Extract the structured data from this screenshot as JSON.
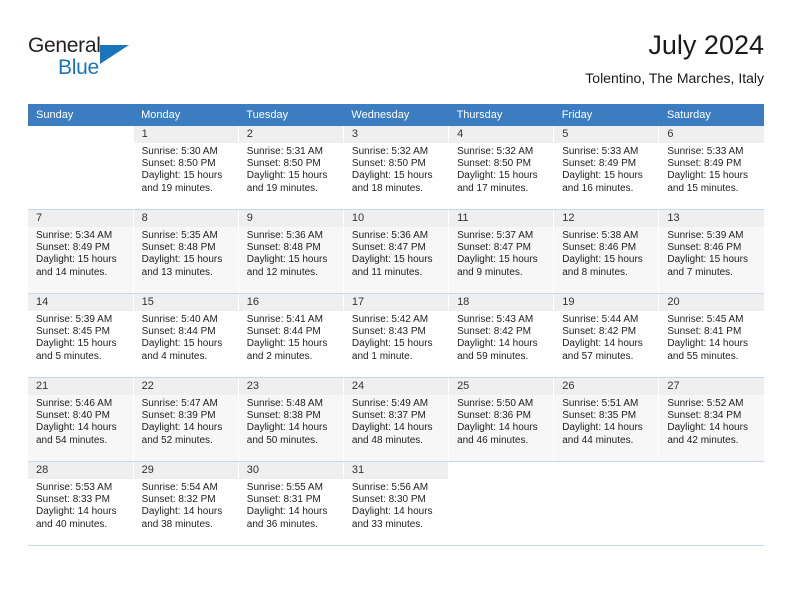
{
  "logo": {
    "word1": "General",
    "word2": "Blue",
    "triangle_color": "#1b75bb",
    "text_color": "#231f20"
  },
  "header": {
    "title": "July 2024",
    "subtitle": "Tolentino, The Marches, Italy"
  },
  "theme": {
    "header_row_bg": "#3b7dc0",
    "header_row_text": "#ffffff",
    "daynum_bg": "#efefef",
    "grid_line": "#c8d8e8"
  },
  "weekday_headers": [
    "Sunday",
    "Monday",
    "Tuesday",
    "Wednesday",
    "Thursday",
    "Friday",
    "Saturday"
  ],
  "weeks": [
    [
      {
        "day": "",
        "sunrise": "",
        "sunset": "",
        "daylight_line1": "",
        "daylight_line2": "",
        "empty": true
      },
      {
        "day": "1",
        "sunrise": "Sunrise: 5:30 AM",
        "sunset": "Sunset: 8:50 PM",
        "daylight_line1": "Daylight: 15 hours",
        "daylight_line2": "and 19 minutes.",
        "empty": false
      },
      {
        "day": "2",
        "sunrise": "Sunrise: 5:31 AM",
        "sunset": "Sunset: 8:50 PM",
        "daylight_line1": "Daylight: 15 hours",
        "daylight_line2": "and 19 minutes.",
        "empty": false
      },
      {
        "day": "3",
        "sunrise": "Sunrise: 5:32 AM",
        "sunset": "Sunset: 8:50 PM",
        "daylight_line1": "Daylight: 15 hours",
        "daylight_line2": "and 18 minutes.",
        "empty": false
      },
      {
        "day": "4",
        "sunrise": "Sunrise: 5:32 AM",
        "sunset": "Sunset: 8:50 PM",
        "daylight_line1": "Daylight: 15 hours",
        "daylight_line2": "and 17 minutes.",
        "empty": false
      },
      {
        "day": "5",
        "sunrise": "Sunrise: 5:33 AM",
        "sunset": "Sunset: 8:49 PM",
        "daylight_line1": "Daylight: 15 hours",
        "daylight_line2": "and 16 minutes.",
        "empty": false
      },
      {
        "day": "6",
        "sunrise": "Sunrise: 5:33 AM",
        "sunset": "Sunset: 8:49 PM",
        "daylight_line1": "Daylight: 15 hours",
        "daylight_line2": "and 15 minutes.",
        "empty": false
      }
    ],
    [
      {
        "day": "7",
        "sunrise": "Sunrise: 5:34 AM",
        "sunset": "Sunset: 8:49 PM",
        "daylight_line1": "Daylight: 15 hours",
        "daylight_line2": "and 14 minutes.",
        "empty": false
      },
      {
        "day": "8",
        "sunrise": "Sunrise: 5:35 AM",
        "sunset": "Sunset: 8:48 PM",
        "daylight_line1": "Daylight: 15 hours",
        "daylight_line2": "and 13 minutes.",
        "empty": false
      },
      {
        "day": "9",
        "sunrise": "Sunrise: 5:36 AM",
        "sunset": "Sunset: 8:48 PM",
        "daylight_line1": "Daylight: 15 hours",
        "daylight_line2": "and 12 minutes.",
        "empty": false
      },
      {
        "day": "10",
        "sunrise": "Sunrise: 5:36 AM",
        "sunset": "Sunset: 8:47 PM",
        "daylight_line1": "Daylight: 15 hours",
        "daylight_line2": "and 11 minutes.",
        "empty": false
      },
      {
        "day": "11",
        "sunrise": "Sunrise: 5:37 AM",
        "sunset": "Sunset: 8:47 PM",
        "daylight_line1": "Daylight: 15 hours",
        "daylight_line2": "and 9 minutes.",
        "empty": false
      },
      {
        "day": "12",
        "sunrise": "Sunrise: 5:38 AM",
        "sunset": "Sunset: 8:46 PM",
        "daylight_line1": "Daylight: 15 hours",
        "daylight_line2": "and 8 minutes.",
        "empty": false
      },
      {
        "day": "13",
        "sunrise": "Sunrise: 5:39 AM",
        "sunset": "Sunset: 8:46 PM",
        "daylight_line1": "Daylight: 15 hours",
        "daylight_line2": "and 7 minutes.",
        "empty": false
      }
    ],
    [
      {
        "day": "14",
        "sunrise": "Sunrise: 5:39 AM",
        "sunset": "Sunset: 8:45 PM",
        "daylight_line1": "Daylight: 15 hours",
        "daylight_line2": "and 5 minutes.",
        "empty": false
      },
      {
        "day": "15",
        "sunrise": "Sunrise: 5:40 AM",
        "sunset": "Sunset: 8:44 PM",
        "daylight_line1": "Daylight: 15 hours",
        "daylight_line2": "and 4 minutes.",
        "empty": false
      },
      {
        "day": "16",
        "sunrise": "Sunrise: 5:41 AM",
        "sunset": "Sunset: 8:44 PM",
        "daylight_line1": "Daylight: 15 hours",
        "daylight_line2": "and 2 minutes.",
        "empty": false
      },
      {
        "day": "17",
        "sunrise": "Sunrise: 5:42 AM",
        "sunset": "Sunset: 8:43 PM",
        "daylight_line1": "Daylight: 15 hours",
        "daylight_line2": "and 1 minute.",
        "empty": false
      },
      {
        "day": "18",
        "sunrise": "Sunrise: 5:43 AM",
        "sunset": "Sunset: 8:42 PM",
        "daylight_line1": "Daylight: 14 hours",
        "daylight_line2": "and 59 minutes.",
        "empty": false
      },
      {
        "day": "19",
        "sunrise": "Sunrise: 5:44 AM",
        "sunset": "Sunset: 8:42 PM",
        "daylight_line1": "Daylight: 14 hours",
        "daylight_line2": "and 57 minutes.",
        "empty": false
      },
      {
        "day": "20",
        "sunrise": "Sunrise: 5:45 AM",
        "sunset": "Sunset: 8:41 PM",
        "daylight_line1": "Daylight: 14 hours",
        "daylight_line2": "and 55 minutes.",
        "empty": false
      }
    ],
    [
      {
        "day": "21",
        "sunrise": "Sunrise: 5:46 AM",
        "sunset": "Sunset: 8:40 PM",
        "daylight_line1": "Daylight: 14 hours",
        "daylight_line2": "and 54 minutes.",
        "empty": false
      },
      {
        "day": "22",
        "sunrise": "Sunrise: 5:47 AM",
        "sunset": "Sunset: 8:39 PM",
        "daylight_line1": "Daylight: 14 hours",
        "daylight_line2": "and 52 minutes.",
        "empty": false
      },
      {
        "day": "23",
        "sunrise": "Sunrise: 5:48 AM",
        "sunset": "Sunset: 8:38 PM",
        "daylight_line1": "Daylight: 14 hours",
        "daylight_line2": "and 50 minutes.",
        "empty": false
      },
      {
        "day": "24",
        "sunrise": "Sunrise: 5:49 AM",
        "sunset": "Sunset: 8:37 PM",
        "daylight_line1": "Daylight: 14 hours",
        "daylight_line2": "and 48 minutes.",
        "empty": false
      },
      {
        "day": "25",
        "sunrise": "Sunrise: 5:50 AM",
        "sunset": "Sunset: 8:36 PM",
        "daylight_line1": "Daylight: 14 hours",
        "daylight_line2": "and 46 minutes.",
        "empty": false
      },
      {
        "day": "26",
        "sunrise": "Sunrise: 5:51 AM",
        "sunset": "Sunset: 8:35 PM",
        "daylight_line1": "Daylight: 14 hours",
        "daylight_line2": "and 44 minutes.",
        "empty": false
      },
      {
        "day": "27",
        "sunrise": "Sunrise: 5:52 AM",
        "sunset": "Sunset: 8:34 PM",
        "daylight_line1": "Daylight: 14 hours",
        "daylight_line2": "and 42 minutes.",
        "empty": false
      }
    ],
    [
      {
        "day": "28",
        "sunrise": "Sunrise: 5:53 AM",
        "sunset": "Sunset: 8:33 PM",
        "daylight_line1": "Daylight: 14 hours",
        "daylight_line2": "and 40 minutes.",
        "empty": false
      },
      {
        "day": "29",
        "sunrise": "Sunrise: 5:54 AM",
        "sunset": "Sunset: 8:32 PM",
        "daylight_line1": "Daylight: 14 hours",
        "daylight_line2": "and 38 minutes.",
        "empty": false
      },
      {
        "day": "30",
        "sunrise": "Sunrise: 5:55 AM",
        "sunset": "Sunset: 8:31 PM",
        "daylight_line1": "Daylight: 14 hours",
        "daylight_line2": "and 36 minutes.",
        "empty": false
      },
      {
        "day": "31",
        "sunrise": "Sunrise: 5:56 AM",
        "sunset": "Sunset: 8:30 PM",
        "daylight_line1": "Daylight: 14 hours",
        "daylight_line2": "and 33 minutes.",
        "empty": false
      },
      {
        "day": "",
        "sunrise": "",
        "sunset": "",
        "daylight_line1": "",
        "daylight_line2": "",
        "empty": true
      },
      {
        "day": "",
        "sunrise": "",
        "sunset": "",
        "daylight_line1": "",
        "daylight_line2": "",
        "empty": true
      },
      {
        "day": "",
        "sunrise": "",
        "sunset": "",
        "daylight_line1": "",
        "daylight_line2": "",
        "empty": true
      }
    ]
  ]
}
